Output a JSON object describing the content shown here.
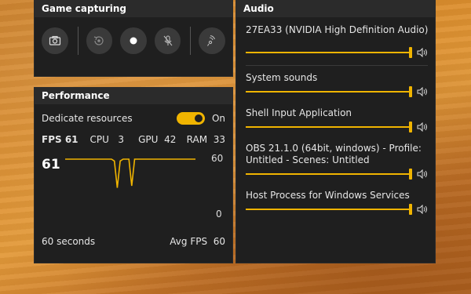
{
  "capture": {
    "title": "Game capturing",
    "buttons": [
      {
        "icon": "camera-icon"
      },
      {
        "icon": "record-last-icon"
      },
      {
        "icon": "record-dot-icon"
      },
      {
        "icon": "mic-off-icon"
      },
      {
        "icon": "broadcast-icon"
      }
    ]
  },
  "performance": {
    "title": "Performance",
    "dedicate_label": "Dedicate resources",
    "toggle_state": "On",
    "fps_label": "FPS 61",
    "cpu_label": "CPU",
    "cpu_value": "3",
    "gpu_label": "GPU",
    "gpu_value": "42",
    "ram_label": "RAM",
    "ram_value": "33",
    "current_value": "61",
    "y_max": "60",
    "y_min": "0",
    "window_label": "60 seconds",
    "avg_label": "Avg FPS",
    "avg_value": "60",
    "accent": "#f0b400",
    "fps_history": [
      60,
      60,
      60,
      60,
      60,
      60,
      60,
      60,
      60,
      60,
      60,
      60,
      60,
      60,
      60,
      60,
      60,
      58,
      30,
      58,
      60,
      60,
      60,
      32,
      60,
      60,
      60,
      60,
      60,
      60,
      60,
      60,
      60,
      60,
      60,
      60,
      60,
      60,
      60,
      60,
      60,
      60,
      60,
      60,
      60,
      60
    ]
  },
  "audio": {
    "title": "Audio",
    "device": "27EA33 (NVIDIA High Definition Audio)",
    "device_volume": 1.0,
    "apps": [
      {
        "name": "System sounds",
        "volume": 1.0
      },
      {
        "name": "Shell Input Application",
        "volume": 1.0
      },
      {
        "name": "OBS 21.1.0 (64bit, windows) - Profile: Untitled - Scenes: Untitled",
        "volume": 1.0
      },
      {
        "name": "Host Process for Windows Services",
        "volume": 1.0
      }
    ]
  }
}
